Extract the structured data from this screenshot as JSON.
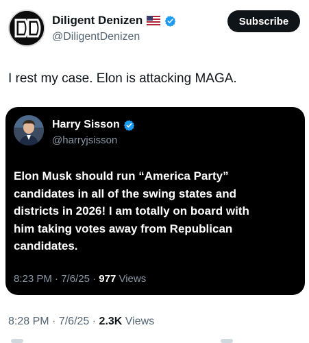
{
  "author": {
    "name": "Diligent Denizen",
    "handle": "@DiligentDenizen",
    "flag_icon": "us-flag-icon",
    "verified_icon": "verified-badge-icon"
  },
  "subscribe_label": "Subscribe",
  "tweet": {
    "text": "I rest my case. Elon is attacking MAGA.",
    "time": "8:28 PM",
    "date": "7/6/25",
    "views_count": "2.3K",
    "views_label": "Views"
  },
  "quote": {
    "name": "Harry Sisson",
    "handle": "@harryjsisson",
    "lines": [
      "Elon Musk should run “America Party”",
      "candidates in all of the swing states and",
      "districts in 2026! I am totally on board with",
      "him taking votes away from Republican",
      "candidates."
    ],
    "time": "8:23 PM",
    "date": "7/6/25",
    "views_count": "977",
    "views_label": "Views"
  },
  "colors": {
    "brand_blue": "#1d9bf0",
    "text_primary": "#0f1419",
    "text_secondary": "#536471",
    "quote_bg": "#000000"
  }
}
